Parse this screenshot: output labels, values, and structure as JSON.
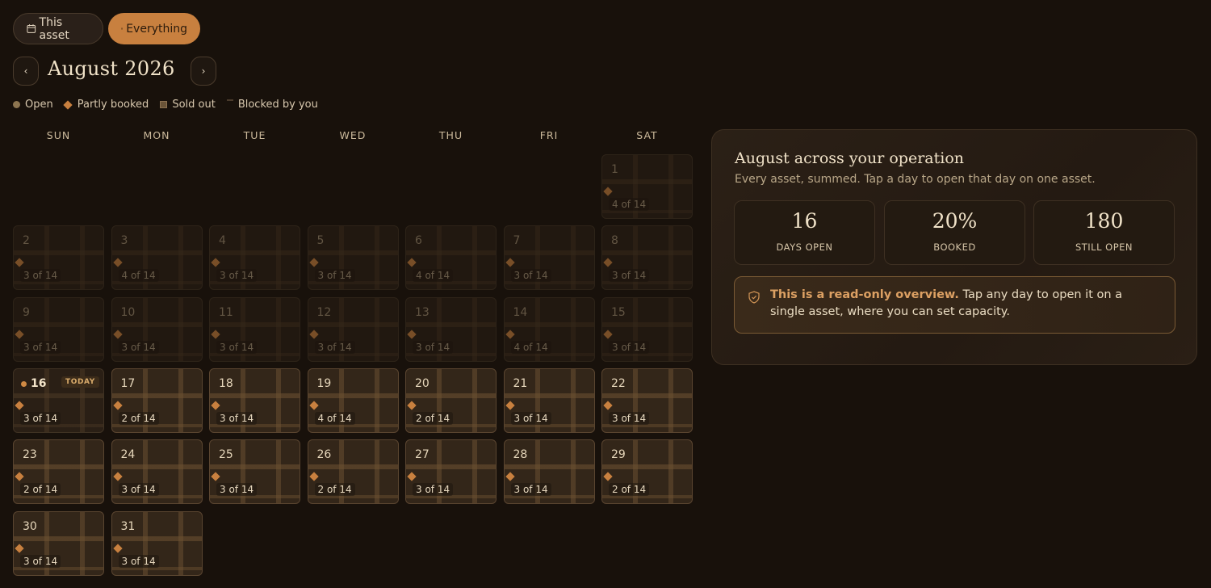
{
  "view_toggle": {
    "this_asset": "This asset",
    "everything": "Everything",
    "selected": "everything"
  },
  "month_nav": {
    "title": "August 2026",
    "prev_label": "‹",
    "next_label": "›"
  },
  "legend": {
    "open": "Open",
    "partly_booked": "Partly booked",
    "sold_out": "Sold out",
    "blocked": "Blocked by you"
  },
  "weekdays": [
    "SUN",
    "MON",
    "TUE",
    "WED",
    "THU",
    "FRI",
    "SAT"
  ],
  "today_badge": "TODAY",
  "days": [
    {
      "day": "1",
      "count": "4 of 14",
      "state": "past"
    },
    {
      "day": "2",
      "count": "3 of 14",
      "state": "past"
    },
    {
      "day": "3",
      "count": "4 of 14",
      "state": "past"
    },
    {
      "day": "4",
      "count": "3 of 14",
      "state": "past"
    },
    {
      "day": "5",
      "count": "3 of 14",
      "state": "past"
    },
    {
      "day": "6",
      "count": "4 of 14",
      "state": "past"
    },
    {
      "day": "7",
      "count": "3 of 14",
      "state": "past"
    },
    {
      "day": "8",
      "count": "3 of 14",
      "state": "past"
    },
    {
      "day": "9",
      "count": "3 of 14",
      "state": "past"
    },
    {
      "day": "10",
      "count": "3 of 14",
      "state": "past"
    },
    {
      "day": "11",
      "count": "3 of 14",
      "state": "past"
    },
    {
      "day": "12",
      "count": "3 of 14",
      "state": "past"
    },
    {
      "day": "13",
      "count": "3 of 14",
      "state": "past"
    },
    {
      "day": "14",
      "count": "4 of 14",
      "state": "past"
    },
    {
      "day": "15",
      "count": "3 of 14",
      "state": "past"
    },
    {
      "day": "16",
      "count": "3 of 14",
      "state": "today"
    },
    {
      "day": "17",
      "count": "2 of 14",
      "state": "current"
    },
    {
      "day": "18",
      "count": "3 of 14",
      "state": "current"
    },
    {
      "day": "19",
      "count": "4 of 14",
      "state": "current"
    },
    {
      "day": "20",
      "count": "2 of 14",
      "state": "current"
    },
    {
      "day": "21",
      "count": "3 of 14",
      "state": "current"
    },
    {
      "day": "22",
      "count": "3 of 14",
      "state": "current"
    },
    {
      "day": "23",
      "count": "2 of 14",
      "state": "current"
    },
    {
      "day": "24",
      "count": "3 of 14",
      "state": "current"
    },
    {
      "day": "25",
      "count": "3 of 14",
      "state": "current"
    },
    {
      "day": "26",
      "count": "2 of 14",
      "state": "current"
    },
    {
      "day": "27",
      "count": "3 of 14",
      "state": "current"
    },
    {
      "day": "28",
      "count": "3 of 14",
      "state": "current"
    },
    {
      "day": "29",
      "count": "2 of 14",
      "state": "current"
    },
    {
      "day": "30",
      "count": "3 of 14",
      "state": "current"
    },
    {
      "day": "31",
      "count": "3 of 14",
      "state": "current"
    }
  ],
  "summary": {
    "title": "August across your operation",
    "subtitle": "Every asset, summed. Tap a day to open that day on one asset.",
    "stats": [
      {
        "value": "16",
        "label": "DAYS OPEN"
      },
      {
        "value": "20%",
        "label": "BOOKED"
      },
      {
        "value": "180",
        "label": "STILL OPEN"
      }
    ],
    "note_strong": "This is a read-only overview.",
    "note_rest": " Tap any day to open it on a single asset, where you can set capacity."
  },
  "colors": {
    "background": "#18110b",
    "accent": "#c8803f",
    "panel": "#2b2016"
  },
  "icons": {
    "this_asset": "calendar-icon",
    "everything": "grid-icon",
    "note": "shield-icon"
  }
}
